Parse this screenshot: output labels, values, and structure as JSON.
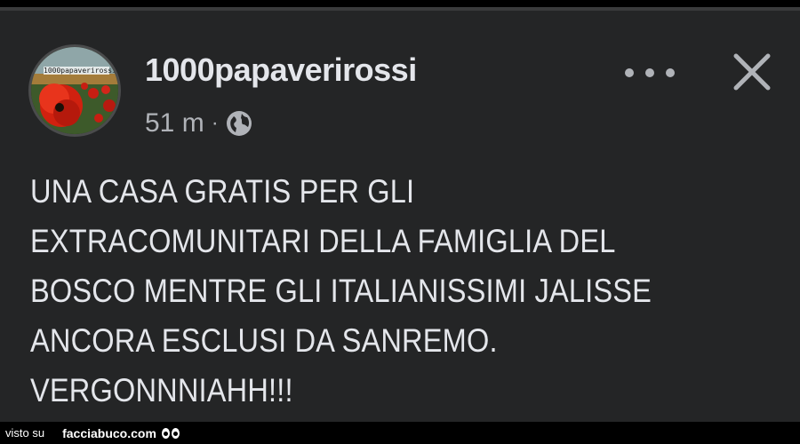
{
  "post": {
    "author": "1000papaverirossi",
    "avatar_label": "1000papaverirossi",
    "time": "51 m",
    "separator": "·",
    "visibility_icon": "globe-icon",
    "text": "UNA CASA GRATIS PER GLI\nEXTRACOMUNITARI DELLA FAMIGLIA DEL\nBOSCO MENTRE GLI ITALIANISSIMI JALISSE\nANCORA ESCLUSI DA SANREMO.\nVERGONNNIAHH!!!"
  },
  "toolbar": {
    "more_icon": "more-horizontal-icon",
    "close_icon": "close-icon"
  },
  "footer": {
    "seen_on": "visto su",
    "site": "facciabuco.com"
  },
  "colors": {
    "card_bg": "#242526",
    "text_primary": "#e4e6eb",
    "text_secondary": "#b0b3b8"
  }
}
